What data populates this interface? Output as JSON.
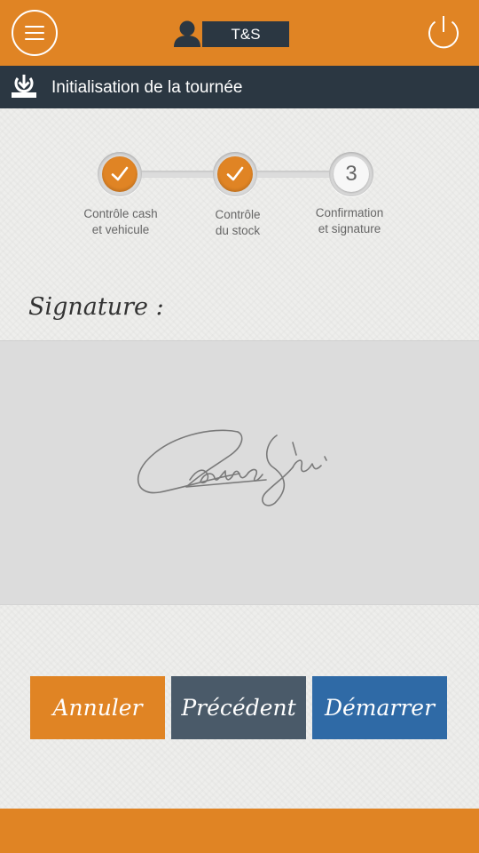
{
  "header": {
    "user_label": "T&S"
  },
  "titlebar": {
    "title": "Initialisation de la tournée"
  },
  "stepper": {
    "steps": [
      {
        "line1": "Contrôle cash",
        "line2": "et vehicule",
        "state": "done"
      },
      {
        "line1": "Contrôle",
        "line2": "du stock",
        "state": "done"
      },
      {
        "line1": "Confirmation",
        "line2": "et signature",
        "state": "current",
        "number": "3"
      }
    ]
  },
  "signature": {
    "heading": "Signature :"
  },
  "actions": {
    "cancel_label": "Annuler",
    "previous_label": "Précédent",
    "start_label": "Démarrer"
  },
  "colors": {
    "accent_orange": "#e08424",
    "dark_bar": "#2b3742",
    "previous_button": "#4a5a69",
    "start_button": "#2f6aa6"
  },
  "icons": {
    "menu": "hamburger-menu-icon",
    "user": "user-icon",
    "power": "power-icon",
    "title": "download-tray-icon",
    "check": "check-icon"
  }
}
